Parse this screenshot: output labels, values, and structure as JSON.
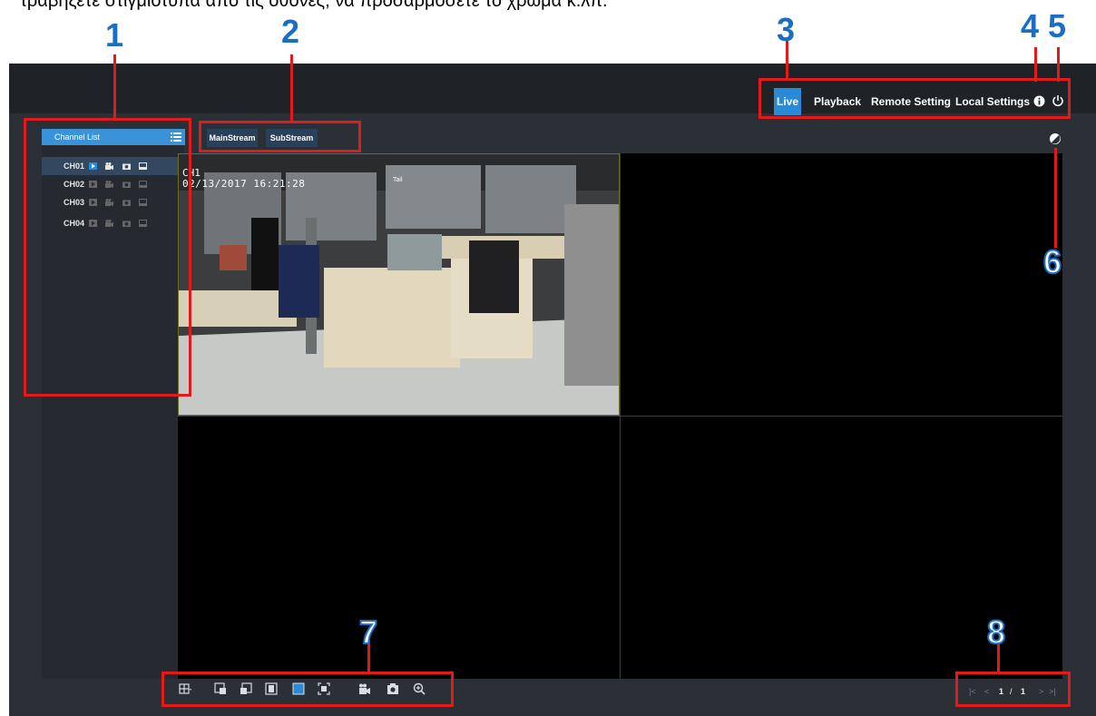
{
  "caption": "τραβήξετε στιγμιότυπα από τις οθόνες, να προσαρμόσετε το χρώμα κ.λπ.",
  "callouts": [
    "1",
    "2",
    "3",
    "4",
    "5",
    "6",
    "7",
    "8"
  ],
  "nav": {
    "tabs": [
      "Live",
      "Playback",
      "Remote Setting",
      "Local Settings"
    ],
    "active": "Live"
  },
  "sidebar": {
    "title": "Channel List",
    "channels": [
      {
        "label": "CH01",
        "selected": true
      },
      {
        "label": "CH02",
        "selected": false
      },
      {
        "label": "CH03",
        "selected": false
      },
      {
        "label": "CH04",
        "selected": false
      }
    ]
  },
  "stream": {
    "main": "MainStream",
    "sub": "SubStream"
  },
  "camera": {
    "channel_label": "CH1",
    "timestamp": "02/13/2017 16:21:28",
    "tag": "Tail"
  },
  "pagination": {
    "current": "1",
    "separator": "/",
    "total": "1"
  },
  "colors": {
    "accent": "#2b8ad6",
    "highlight": "#e01b1b",
    "callout": "#1a6fc4"
  },
  "icons": [
    "info-icon",
    "power-icon",
    "color-adjust-icon",
    "play-icon",
    "record-icon",
    "snapshot-icon",
    "screen-icon",
    "layout-icon",
    "prev-group-icon",
    "next-group-icon",
    "fullscreen-single-icon",
    "fill-screen-icon",
    "original-size-icon",
    "record-all-icon",
    "snapshot-all-icon",
    "zoom-icon"
  ]
}
